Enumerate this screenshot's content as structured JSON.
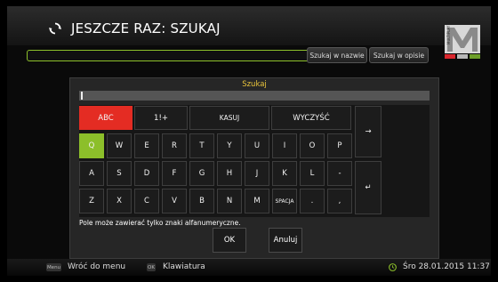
{
  "header": {
    "title": "JESZCZE RAZ: SZUKAJ",
    "logo_text": "MULTIPLAY"
  },
  "search_bar": {
    "value": "",
    "buttons": [
      "Szukaj w nazwie",
      "Szukaj w opisie"
    ]
  },
  "dialog": {
    "title": "Szukaj",
    "input_value": "",
    "hint": "Pole może zawierać tylko znaki alfanumeryczne.",
    "ok_label": "OK",
    "cancel_label": "Anuluj"
  },
  "keyboard": {
    "top_row": [
      "ABC",
      "1!+",
      "KASUJ",
      "WYCZYŚĆ"
    ],
    "row1": [
      "Q",
      "W",
      "E",
      "R",
      "T",
      "Y",
      "U",
      "I",
      "O",
      "P"
    ],
    "row2": [
      "A",
      "S",
      "D",
      "F",
      "G",
      "H",
      "J",
      "K",
      "L",
      "-"
    ],
    "row3": [
      "Z",
      "X",
      "C",
      "V",
      "B",
      "N",
      "M",
      "SPACJA",
      ".",
      ","
    ],
    "right_arrow": "→",
    "enter": "↵",
    "active_mode": "ABC",
    "selected_key": "Q"
  },
  "footer": {
    "menu_key": "Menu",
    "menu_label": "Wróć do menu",
    "ok_key": "OK",
    "keyboard_label": "Klawiatura",
    "datetime": "Śro 28.01.2015 11:37"
  },
  "colors": {
    "accent_green": "#8cbf2a",
    "accent_red": "#e42c23",
    "title_yellow": "#e8c33b"
  }
}
